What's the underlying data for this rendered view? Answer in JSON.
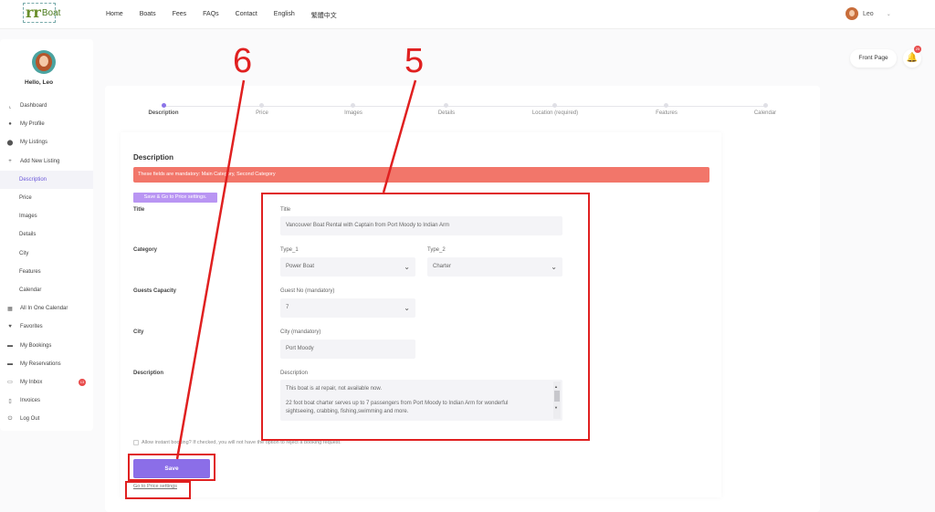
{
  "header": {
    "logo_text": "Boat",
    "nav": [
      "Home",
      "Boats",
      "Fees",
      "FAQs",
      "Contact",
      "English",
      "繁體中文"
    ],
    "user_name": "Leo",
    "caret": "⌄"
  },
  "sidebar": {
    "hello": "Hello, Leo",
    "items": [
      {
        "label": "Dashboard",
        "icon": "chart-icon"
      },
      {
        "label": "My Profile",
        "icon": "user-icon"
      },
      {
        "label": "My Listings",
        "icon": "pin-icon"
      },
      {
        "label": "Add New Listing",
        "icon": "plus-icon"
      },
      {
        "label": "Description",
        "icon": ""
      },
      {
        "label": "Price",
        "icon": ""
      },
      {
        "label": "Images",
        "icon": ""
      },
      {
        "label": "Details",
        "icon": ""
      },
      {
        "label": "City",
        "icon": ""
      },
      {
        "label": "Features",
        "icon": ""
      },
      {
        "label": "Calendar",
        "icon": ""
      },
      {
        "label": "All In One Calendar",
        "icon": "calendar-icon"
      },
      {
        "label": "Favorites",
        "icon": "heart-icon"
      },
      {
        "label": "My Bookings",
        "icon": "folder-icon"
      },
      {
        "label": "My Reservations",
        "icon": "folder-icon"
      },
      {
        "label": "My Inbox",
        "icon": "inbox-icon",
        "badge": "13"
      },
      {
        "label": "Invoices",
        "icon": "document-icon"
      },
      {
        "label": "Log Out",
        "icon": "power-icon"
      }
    ]
  },
  "top_actions": {
    "front_page": "Front Page",
    "bell_badge": "25"
  },
  "steps": [
    "Description",
    "Price",
    "Images",
    "Details",
    "Location (required)",
    "Features",
    "Calendar"
  ],
  "form": {
    "section_title": "Description",
    "alert": "These fields are mandatory: Main Category, Second Category",
    "save_go": "Save & Go to Price settings.",
    "labels": {
      "title": "Title",
      "category": "Category",
      "guests": "Guests Capacity",
      "city": "City",
      "description": "Description"
    },
    "title_label": "Title",
    "title_value": "Vancouver Boat Rental with Captain from Port Moody to Indian Arm",
    "type1_label": "Type_1",
    "type1_value": "Power Boat",
    "type2_label": "Type_2",
    "type2_value": "Charter",
    "guest_label": "Guest No (mandatory)",
    "guest_value": "7",
    "city_label": "City (mandatory)",
    "city_value": "Port Moody",
    "desc_label": "Description",
    "desc_line1": "This boat is at repair, not available now.",
    "desc_line2": "22 foot boat charter serves up to 7 passengers from Port Moody to Indian Arm for wonderful",
    "desc_line3": "sightseeing, crabbing, fishing,swimming and more.",
    "instant_booking": "Allow instant booking? If checked, you will not have the option to reject a booking request.",
    "save": "Save",
    "go_price": "Go to Price settings"
  },
  "annotations": {
    "num5": "5",
    "num6": "6"
  },
  "colors": {
    "accent": "#8b6ee8",
    "alert": "#f2766a",
    "annotation": "#e02020"
  }
}
